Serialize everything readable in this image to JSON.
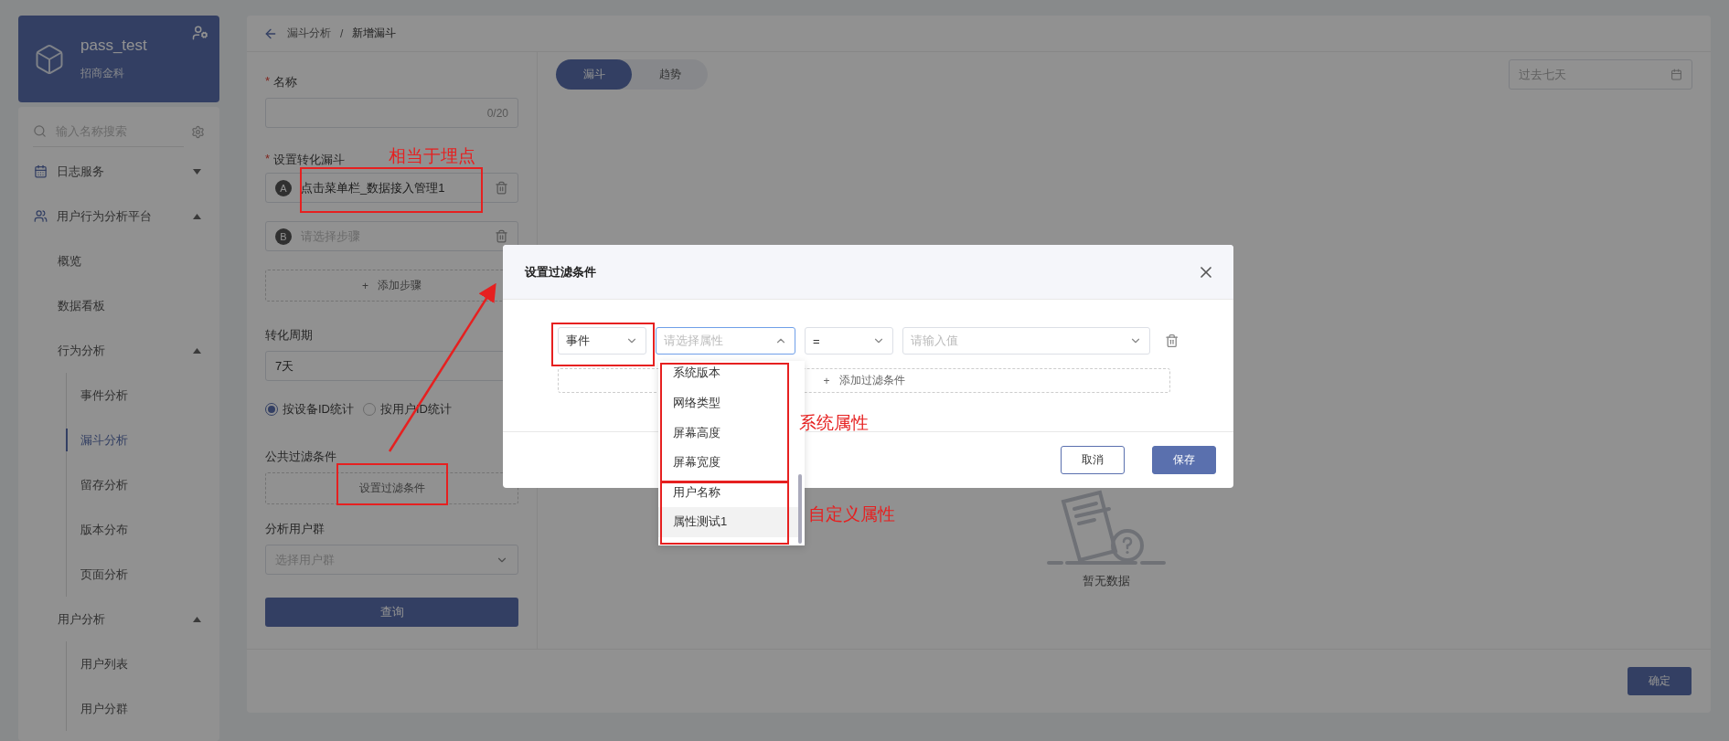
{
  "sidebar": {
    "org": {
      "name": "pass_test",
      "subtitle": "招商金科"
    },
    "search": {
      "placeholder": "输入名称搜索"
    },
    "menu": [
      {
        "label": "日志服务",
        "expanded": false
      },
      {
        "label": "用户行为分析平台",
        "expanded": true,
        "children": [
          {
            "label": "概览",
            "selected": false
          },
          {
            "label": "数据看板",
            "selected": false
          },
          {
            "label": "行为分析",
            "expanded": true,
            "children": [
              {
                "label": "事件分析",
                "selected": false
              },
              {
                "label": "漏斗分析",
                "selected": true
              },
              {
                "label": "留存分析",
                "selected": false
              },
              {
                "label": "版本分布",
                "selected": false
              },
              {
                "label": "页面分析",
                "selected": false
              }
            ]
          },
          {
            "label": "用户分析",
            "expanded": true,
            "children": [
              {
                "label": "用户列表",
                "selected": false
              },
              {
                "label": "用户分群",
                "selected": false
              }
            ]
          }
        ]
      }
    ]
  },
  "breadcrumb": [
    "漏斗分析",
    "新增漏斗"
  ],
  "breadcrumb_separator": "/",
  "form": {
    "name": {
      "required": "*",
      "label": "名称",
      "counter": "0/20"
    },
    "funnel": {
      "required": "*",
      "label": "设置转化漏斗",
      "steps": [
        {
          "badge": "A",
          "value": "点击菜单栏_数据接入管理1"
        },
        {
          "badge": "B",
          "placeholder": "请选择步骤"
        }
      ],
      "add_icon": "+",
      "add": "添加步骤"
    },
    "period": {
      "label": "转化周期",
      "value": "7天"
    },
    "count_by": [
      {
        "label": "按设备ID统计",
        "selected": true
      },
      {
        "label": "按用户ID统计",
        "selected": false
      }
    ],
    "filter": {
      "label": "公共过滤条件",
      "button": "设置过滤条件"
    },
    "group": {
      "label": "分析用户群",
      "placeholder": "选择用户群"
    },
    "submit": "查询"
  },
  "view_tabs": [
    {
      "label": "漏斗",
      "selected": true
    },
    {
      "label": "趋势",
      "selected": false
    }
  ],
  "date_range": {
    "placeholder": "过去七天"
  },
  "empty": {
    "text": "暂无数据"
  },
  "footer": {
    "confirm": "确定"
  },
  "modal": {
    "title": "设置过滤条件",
    "condition": {
      "scope": "事件",
      "attribute": {
        "placeholder": "请选择属性",
        "expanded": true
      },
      "operator": "=",
      "value": {
        "placeholder": "请输入值"
      }
    },
    "add": {
      "icon": "+",
      "label": "添加过滤条件"
    },
    "buttons": [
      {
        "label": "取消",
        "kind": "secondary"
      },
      {
        "label": "保存",
        "kind": "primary"
      }
    ]
  },
  "attribute_options": [
    {
      "label": "系统版本",
      "highlighted": false
    },
    {
      "label": "网络类型",
      "highlighted": false
    },
    {
      "label": "屏幕高度",
      "highlighted": false
    },
    {
      "label": "屏幕宽度",
      "highlighted": false
    },
    {
      "label": "用户名称",
      "highlighted": false
    },
    {
      "label": "属性测试1",
      "highlighted": true
    }
  ],
  "annotations": [
    "相当于埋点",
    "系统属性",
    "自定义属性"
  ]
}
